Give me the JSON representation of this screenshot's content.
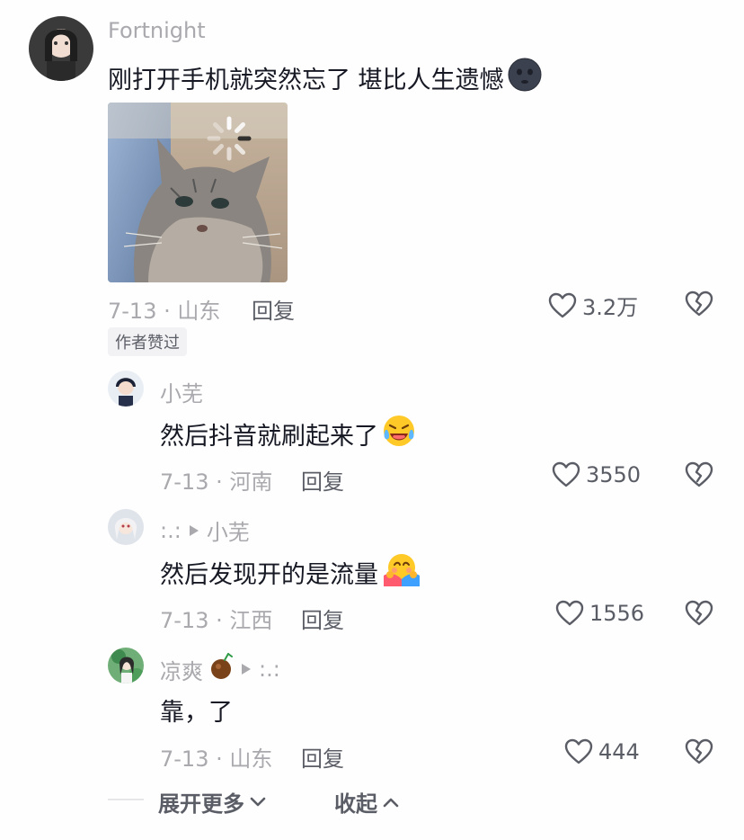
{
  "top_comment": {
    "username": "Fortnight",
    "text": "刚打开手机就突然忘了 堪比人生遗憾",
    "date_location": "7-13 · 山东",
    "reply_label": "回复",
    "likes": "3.2万",
    "badge": "作者赞过"
  },
  "replies": [
    {
      "username": "小芜",
      "reply_to": "",
      "text": "然后抖音就刷起来了",
      "date_location": "7-13 · 河南",
      "reply_label": "回复",
      "likes": "3550"
    },
    {
      "username": ":.:",
      "reply_to": "小芜",
      "text": "然后发现开的是流量",
      "date_location": "7-13 · 江西",
      "reply_label": "回复",
      "likes": "1556"
    },
    {
      "username": "凉爽",
      "reply_to": ":.:",
      "text": "靠，了",
      "date_location": "7-13 · 山东",
      "reply_label": "回复",
      "likes": "444"
    }
  ],
  "footer": {
    "expand_label": "展开更多",
    "collapse_label": "收起"
  },
  "colors": {
    "primary_text": "#161823",
    "secondary_text": "#a9a9ae",
    "action_text": "#5b5d66"
  }
}
